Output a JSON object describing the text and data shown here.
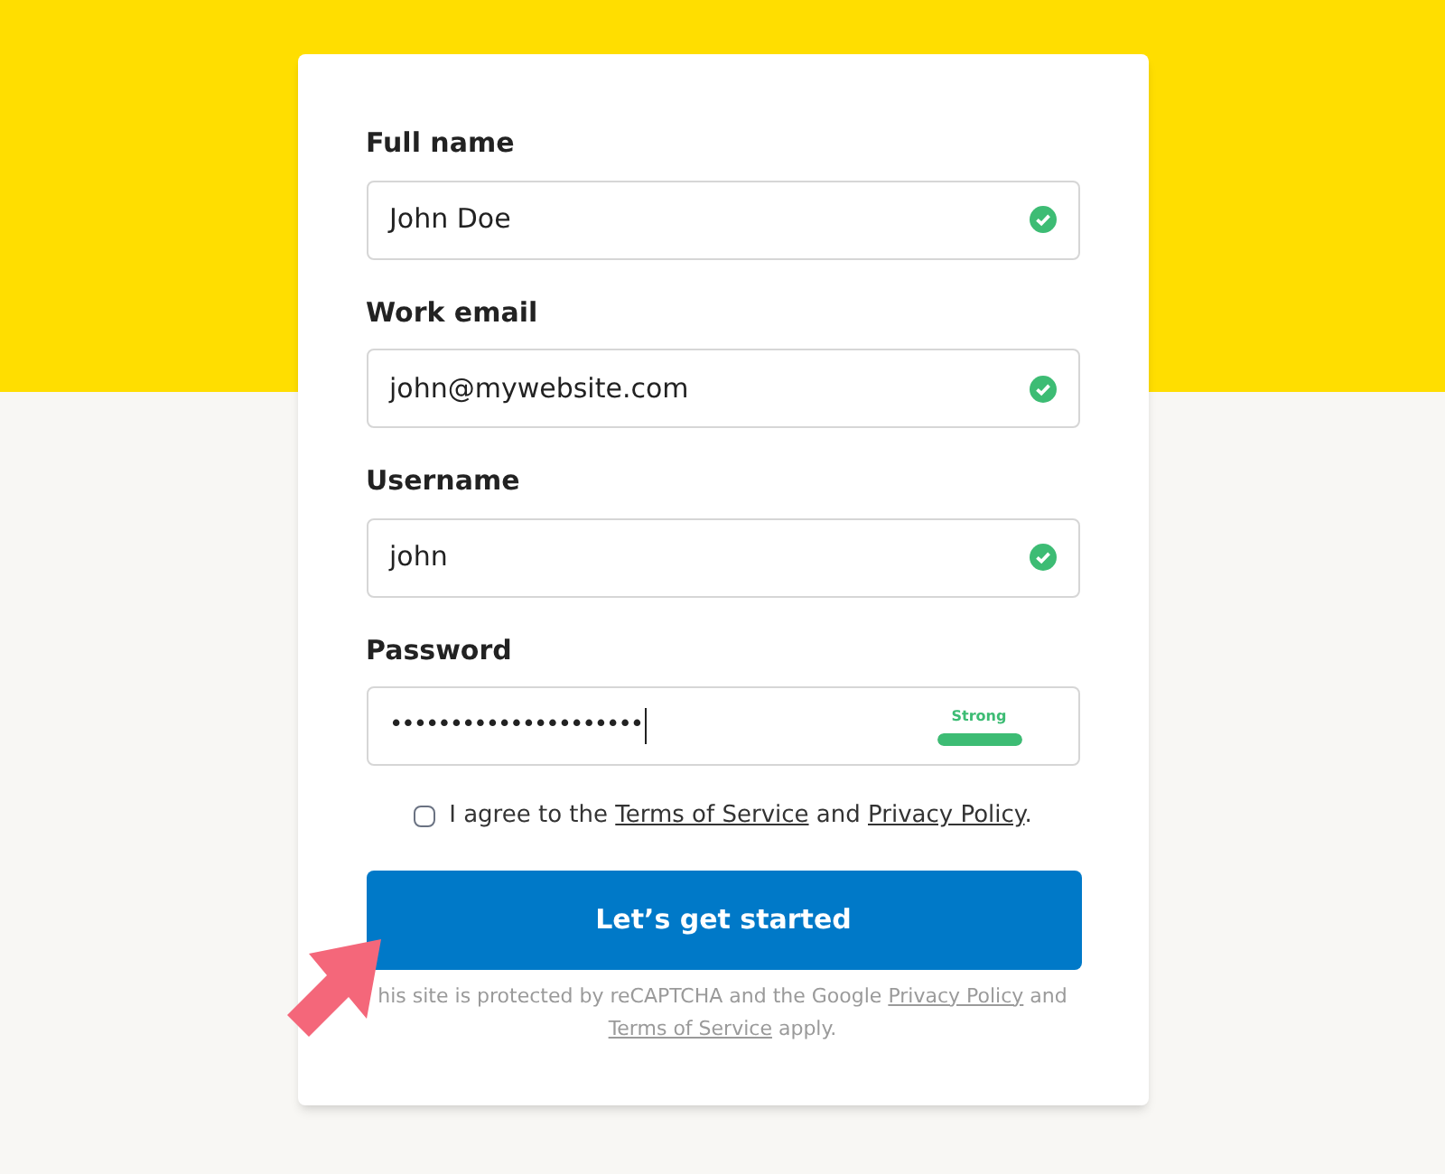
{
  "fields": [
    {
      "kind": "text",
      "label": "Full name",
      "value": "John Doe",
      "valid": true
    },
    {
      "kind": "text",
      "label": "Work email",
      "value": "john@mywebsite.com",
      "valid": true
    },
    {
      "kind": "text",
      "label": "Username",
      "value": "john",
      "valid": true
    },
    {
      "kind": "password",
      "label": "Password",
      "value": "•••••••••••••••••••••",
      "strength": "Strong",
      "level": 1
    }
  ],
  "agree": {
    "checked": false,
    "before": "I agree to the",
    "link1": "Terms of Service",
    "middle": "and",
    "link2": "Privacy Policy",
    "after": "."
  },
  "submit": "Let’s get started",
  "notice": {
    "before": "his site is protected by reCAPTCHA and the Google",
    "link1": "Privacy Policy",
    "middle": "and",
    "link2": "Terms of Service",
    "after": "apply."
  }
}
